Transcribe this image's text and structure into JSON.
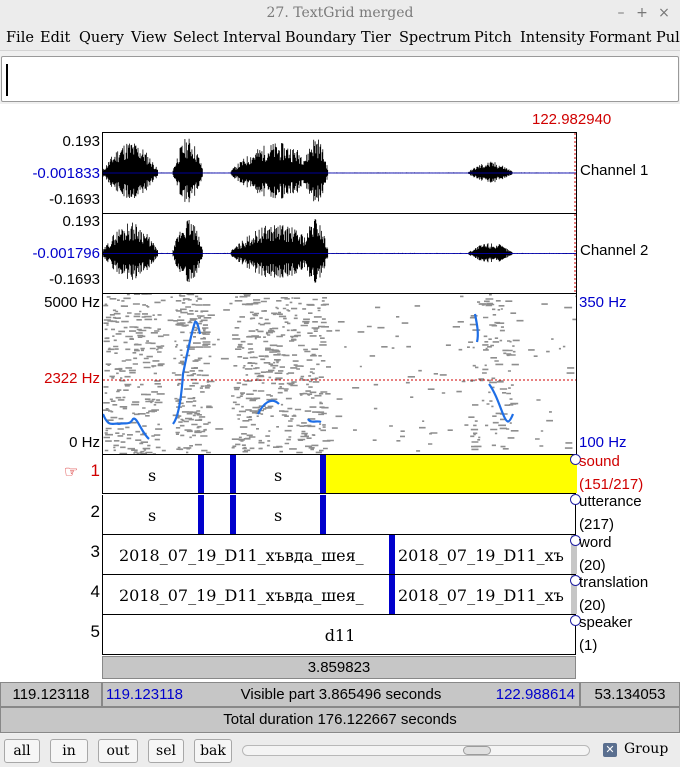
{
  "window": {
    "title": "27. TextGrid merged",
    "min": "–",
    "max": "+",
    "close": "×"
  },
  "menu": [
    "File",
    "Edit",
    "Query",
    "View",
    "Select",
    "Interval",
    "Boundary",
    "Tier",
    "Spectrum",
    "Pitch",
    "Intensity",
    "Formant",
    "Pulses"
  ],
  "cursor_time": "122.982940",
  "channel1": {
    "max": "0.193",
    "mid": "-0.001833",
    "min": "-0.1693",
    "name": "Channel 1"
  },
  "channel2": {
    "max": "0.193",
    "mid": "-0.001796",
    "min": "-0.1693",
    "name": "Channel 2"
  },
  "spectrogram": {
    "top": "5000 Hz",
    "bottom": "0 Hz",
    "marker": "2322 Hz",
    "pitch_top": "350 Hz",
    "pitch_bottom": "100 Hz"
  },
  "tiers": [
    {
      "num": "1",
      "pointer": "☞",
      "name": "sound",
      "count": "(151/217)",
      "labels": [
        "s",
        "s"
      ]
    },
    {
      "num": "2",
      "name": "utterance",
      "count": "(217)",
      "labels": [
        "s",
        "s"
      ]
    },
    {
      "num": "3",
      "name": "word",
      "count": "(20)",
      "labels": [
        "2018_07_19_D11_хъвда_шея_",
        "2018_07_19_D11_хъ"
      ]
    },
    {
      "num": "4",
      "name": "translation",
      "count": "(20)",
      "labels": [
        "2018_07_19_D11_хъвда_шея_",
        "2018_07_19_D11_хъ"
      ]
    },
    {
      "num": "5",
      "name": "speaker",
      "count": "(1)",
      "labels": [
        "d11"
      ]
    }
  ],
  "selection_duration": "3.859823",
  "info": {
    "left_total": "119.123118",
    "visible_start": "119.123118",
    "visible_part": "Visible part 3.865496 seconds",
    "visible_end": "122.988614",
    "right_total": "53.134053"
  },
  "total_duration": "Total duration 176.122667 seconds",
  "buttons": {
    "all": "all",
    "in": "in",
    "out": "out",
    "sel": "sel",
    "bak": "bak"
  },
  "group": {
    "label": "Group",
    "checked": true
  },
  "colors": {
    "selection": "#ffff00",
    "boundary": "#0000cc",
    "cursor_text": "#d00000",
    "pitch": "#1e6ee6"
  }
}
